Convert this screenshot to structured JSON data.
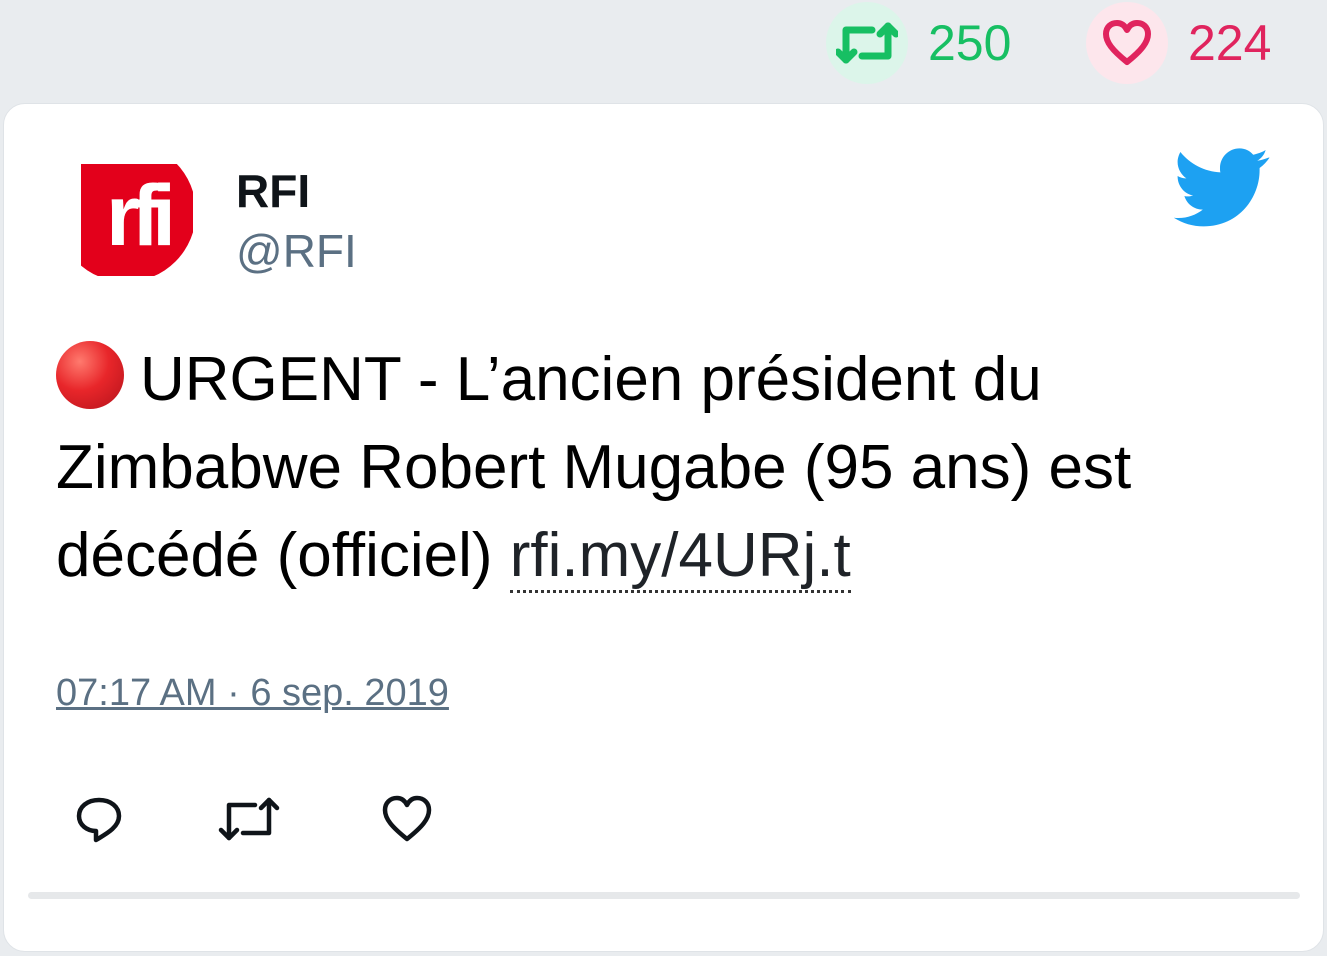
{
  "stats": {
    "retweets": "250",
    "likes": "224",
    "retweet_color": "#17bf63",
    "like_color": "#e0245e"
  },
  "tweet": {
    "author_name": "RFI",
    "author_handle": "@RFI",
    "avatar_text": "rfi",
    "avatar_color": "#e3001b",
    "text_prefix": "URGENT - L’ancien président du Zimbabwe Robert Mugabe (95 ans) est décédé (officiel) ",
    "link_text": "rfi.my/4URj.t",
    "timestamp": "07:17 AM · 6 sep. 2019"
  },
  "icons": {
    "retweet": "retweet-icon",
    "like": "heart-icon",
    "reply": "reply-icon",
    "twitter": "twitter-bird-icon",
    "urgent": "red-circle-icon"
  }
}
